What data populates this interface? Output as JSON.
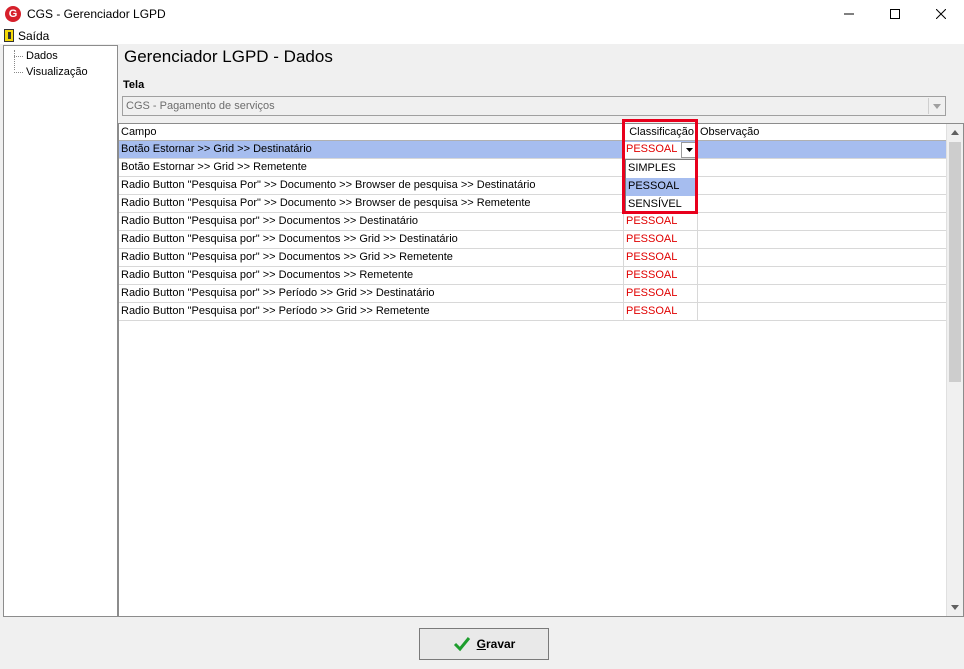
{
  "window": {
    "title": "CGS - Gerenciador LGPD",
    "logo_letter": "G"
  },
  "menu": {
    "exit_label": "Saída"
  },
  "tree": {
    "items": [
      {
        "label": "Dados"
      },
      {
        "label": "Visualização"
      }
    ]
  },
  "page": {
    "title": "Gerenciador LGPD - Dados"
  },
  "tela": {
    "label": "Tela",
    "value": "CGS - Pagamento de serviços"
  },
  "grid": {
    "columns": {
      "campo": "Campo",
      "classificacao": "Classificação",
      "observacao": "Observação"
    },
    "rows": [
      {
        "campo": "Botão Estornar >> Grid >> Destinatário",
        "classificacao": "PESSOAL",
        "observacao": ""
      },
      {
        "campo": "Botão Estornar >> Grid >> Remetente",
        "classificacao": "",
        "observacao": ""
      },
      {
        "campo": "Radio Button \"Pesquisa Por\" >> Documento >> Browser de pesquisa >> Destinatário",
        "classificacao": "",
        "observacao": ""
      },
      {
        "campo": "Radio Button \"Pesquisa Por\" >> Documento >> Browser de pesquisa >> Remetente",
        "classificacao": "",
        "observacao": ""
      },
      {
        "campo": "Radio Button \"Pesquisa por\" >> Documentos >> Destinatário",
        "classificacao": "PESSOAL",
        "observacao": ""
      },
      {
        "campo": "Radio Button \"Pesquisa por\" >> Documentos >> Grid >> Destinatário",
        "classificacao": "PESSOAL",
        "observacao": ""
      },
      {
        "campo": "Radio Button \"Pesquisa por\" >> Documentos >> Grid >> Remetente",
        "classificacao": "PESSOAL",
        "observacao": ""
      },
      {
        "campo": "Radio Button \"Pesquisa por\" >> Documentos >> Remetente",
        "classificacao": "PESSOAL",
        "observacao": ""
      },
      {
        "campo": "Radio Button \"Pesquisa por\" >> Período >> Grid >> Destinatário",
        "classificacao": "PESSOAL",
        "observacao": ""
      },
      {
        "campo": "Radio Button \"Pesquisa por\" >> Período >> Grid >> Remetente",
        "classificacao": "PESSOAL",
        "observacao": ""
      }
    ],
    "editor_value": "PESSOAL",
    "dropdown_options": [
      {
        "label": "SIMPLES"
      },
      {
        "label": "PESSOAL"
      },
      {
        "label": "SENSÍVEL"
      }
    ]
  },
  "buttons": {
    "save_label": "Gravar"
  },
  "colors": {
    "selection": "#a6bdef",
    "value_text": "#e00000",
    "highlight": "#e8001c"
  }
}
